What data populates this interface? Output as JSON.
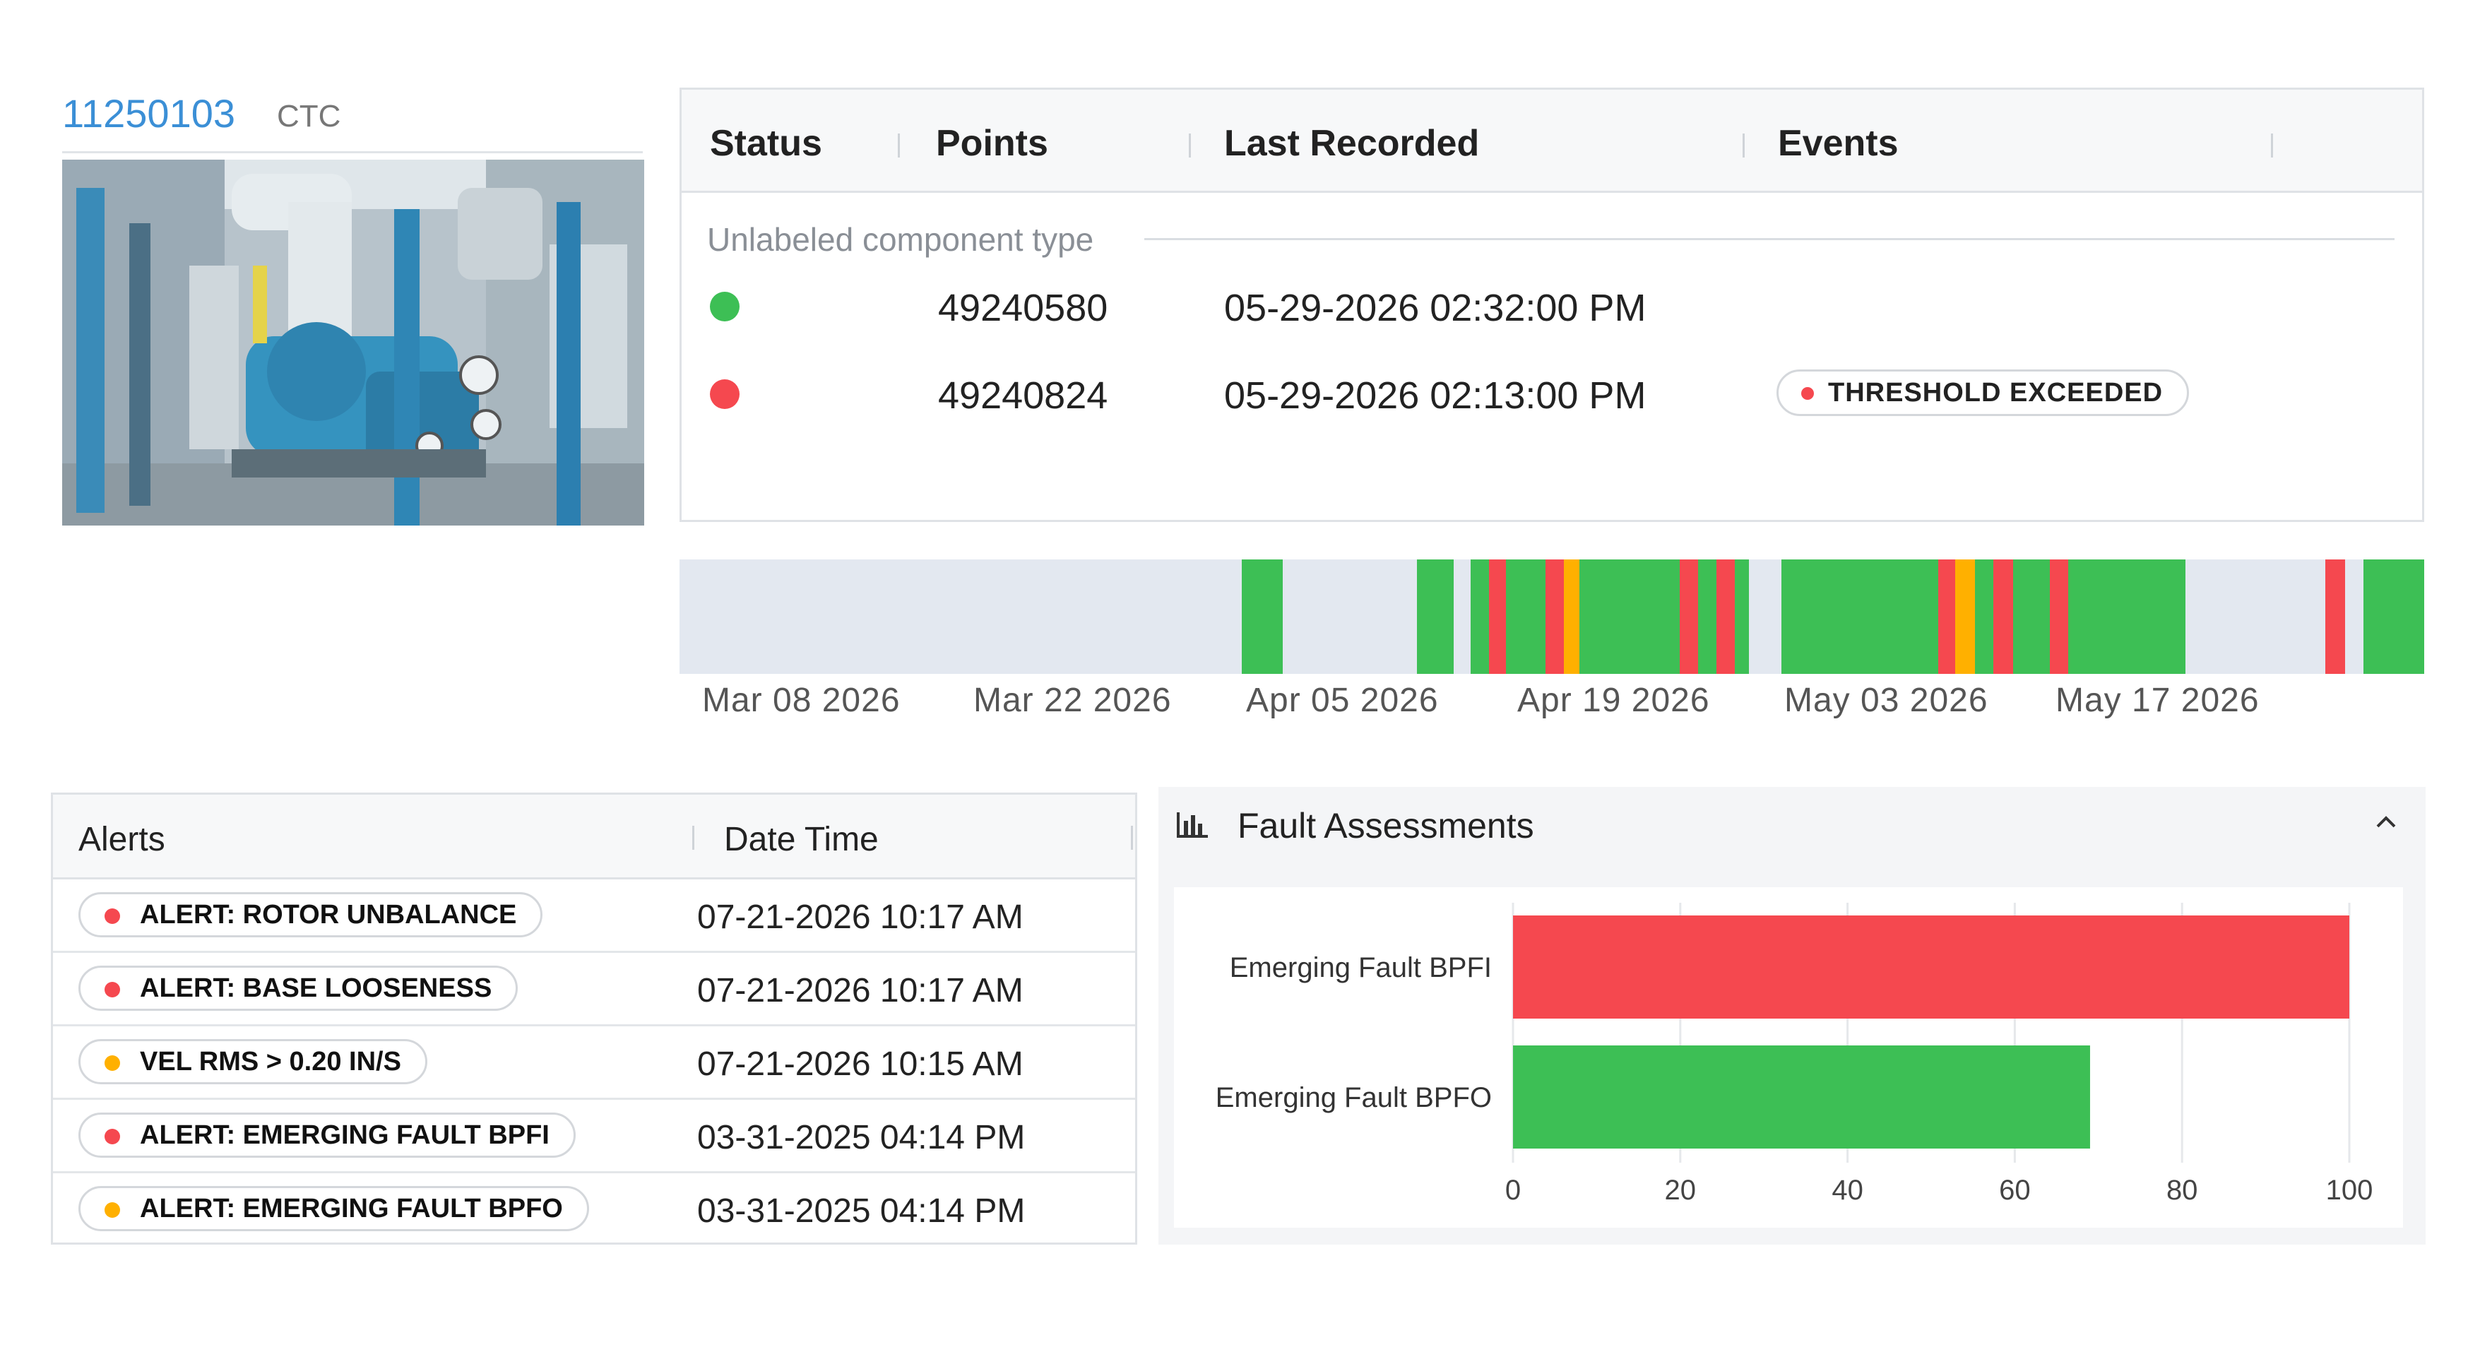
{
  "asset": {
    "id": "11250103",
    "code": "CTC"
  },
  "points_table": {
    "headers": [
      "Status",
      "Points",
      "Last Recorded",
      "Events"
    ],
    "group_label": "Unlabeled component type",
    "rows": [
      {
        "status_color": "#3dbf55",
        "point": "49240580",
        "last_recorded": "05-29-2026 02:32:00 PM",
        "event": null
      },
      {
        "status_color": "#f5484f",
        "point": "49240824",
        "last_recorded": "05-29-2026 02:13:00 PM",
        "event": "THRESHOLD EXCEEDED"
      }
    ]
  },
  "timeline": {
    "labels": [
      "Mar 08 2026",
      "Mar 22 2026",
      "Apr 05 2026",
      "Apr 19 2026",
      "May 03 2026",
      "May 17 2026"
    ],
    "colors": {
      "none": "#e3e8f0",
      "ok": "#3dbf55",
      "alarm": "#f5484f",
      "warning": "#ffb000"
    }
  },
  "alerts": {
    "headers": [
      "Alerts",
      "Date Time"
    ],
    "rows": [
      {
        "label": "ALERT: ROTOR UNBALANCE",
        "color": "#f5484f",
        "datetime": "07-21-2026 10:17 AM"
      },
      {
        "label": "ALERT: BASE LOOSENESS",
        "color": "#f5484f",
        "datetime": "07-21-2026 10:17 AM"
      },
      {
        "label": "VEL RMS > 0.20 IN/S",
        "color": "#ffb000",
        "datetime": "07-21-2026 10:15 AM"
      },
      {
        "label": "ALERT: EMERGING FAULT BPFI",
        "color": "#f5484f",
        "datetime": "03-31-2025 04:14 PM"
      },
      {
        "label": "ALERT: EMERGING FAULT BPFO",
        "color": "#ffb000",
        "datetime": "03-31-2025 04:14 PM"
      }
    ]
  },
  "fault_assessments": {
    "title": "Fault Assessments",
    "icon": "bar-chart-icon",
    "toggle_icon": "chevron-up-icon"
  },
  "chart_data": {
    "type": "bar",
    "orientation": "horizontal",
    "categories": [
      "Emerging Fault BPFI",
      "Emerging Fault BPFO"
    ],
    "values": [
      100,
      69
    ],
    "colors": [
      "#f5484f",
      "#3dbf55"
    ],
    "xlim": [
      0,
      100
    ],
    "xticks": [
      0,
      20,
      40,
      60,
      80,
      100
    ],
    "grid": true
  }
}
